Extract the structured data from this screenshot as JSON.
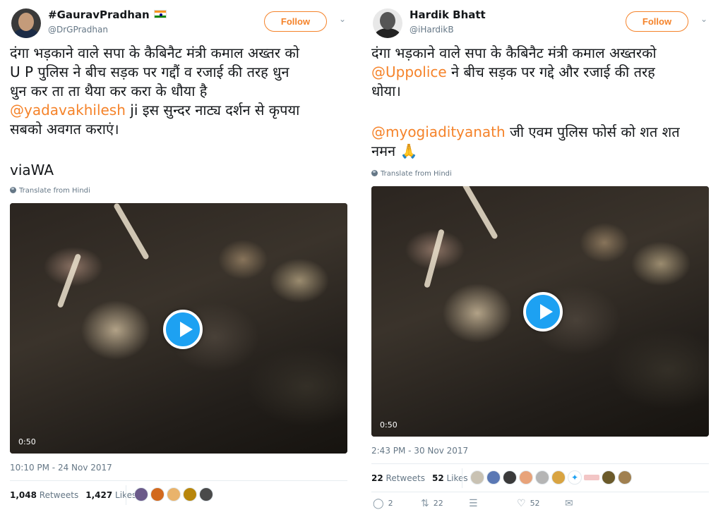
{
  "tweets": [
    {
      "name": "#GauravPradhan",
      "handle": "@DrGPradhan",
      "follow_label": "Follow",
      "text_line1": "दंगा भड़काने वाले सपा के कैबिनैट मंत्री कमाल अख्तर को",
      "text_line2": "U P पुलिस ने बीच सड़क पर गद्दौं व रजाई की तरह धुन",
      "text_line3": "धुन कर ता ता थैया कर करा के धौया है",
      "mention": "@yadavakhilesh",
      "text_line4_rest": " ji इस सुन्दर नाट्य दर्शन से कृपया",
      "text_line5": "सबको अवगत कराएं।",
      "text_via": "viaWA",
      "translate_label": "Translate from Hindi",
      "video_duration": "0:50",
      "timestamp": "10:10 PM - 24 Nov 2017",
      "retweets_count": "1,048",
      "retweets_label": "Retweets",
      "likes_count": "1,427",
      "likes_label": "Likes"
    },
    {
      "name": "Hardik Bhatt",
      "handle": "@iHardikB",
      "follow_label": "Follow",
      "text_line1": "दंगा भड़काने वाले सपा के कैबिनैट मंत्री कमाल अख्तरको",
      "mention1": "@Uppolice",
      "text_line2_rest": " ने बीच सड़क पर गद्दे और रजाई की तरह",
      "text_line3": "धोया।",
      "mention2": "@myogiadityanath",
      "text_line4_rest": " जी एवम पुलिस फोर्स को शत शत",
      "text_line5": "नमन 🙏",
      "translate_label": "Translate from Hindi",
      "video_duration": "0:50",
      "timestamp": "2:43 PM - 30 Nov 2017",
      "retweets_count": "22",
      "retweets_label": "Retweets",
      "likes_count": "52",
      "likes_label": "Likes",
      "replies_count": "2",
      "retweet_action_count": "22",
      "like_action_count": "52"
    }
  ],
  "icons": {
    "reply": "reply-icon",
    "retweet": "retweet-icon",
    "stack": "stack-icon",
    "like": "heart-icon",
    "dm": "mail-icon",
    "caret": "chevron-down-icon",
    "play": "play-icon",
    "globe": "globe-icon"
  },
  "colors": {
    "accent": "#f5832a",
    "play": "#1da1f2",
    "muted": "#657786"
  }
}
